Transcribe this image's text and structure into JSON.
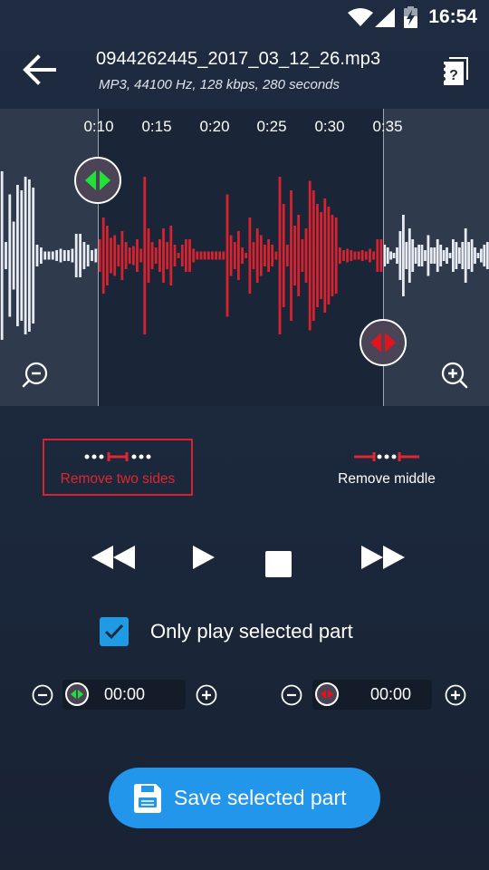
{
  "status_bar": {
    "time": "16:54",
    "icons": [
      "wifi-icon",
      "cellular-signal-icon",
      "battery-charging-icon"
    ]
  },
  "app_bar": {
    "back_icon": "arrow-left-icon",
    "title": "0944262445_2017_03_12_26.mp3",
    "subtitle": "MP3, 44100 Hz, 128 kbps, 280 seconds",
    "help_icon": "help-book-icon"
  },
  "waveform": {
    "timeline_ticks": [
      "0:10",
      "0:15",
      "0:20",
      "0:25",
      "0:30",
      "0:35"
    ],
    "selection_start_label": "0:10",
    "selection_end_label": "0:35",
    "selected_color": "#d7232f",
    "unselected_color": "#e8ecf2",
    "start_handle_color": "#22e03a",
    "end_handle_color": "#e0141e",
    "amplitudes_left": [
      0.62,
      0.1,
      0.45,
      0.25,
      0.52,
      0.48,
      0.58,
      0.56,
      0.5,
      0.08,
      0.06,
      0.03,
      0.03,
      0.03,
      0.04,
      0.05,
      0.04,
      0.04,
      0.05,
      0.16,
      0.16,
      0.1,
      0.08,
      0.04,
      0.05
    ],
    "amplitudes_selected": [
      0.12,
      0.28,
      0.22,
      0.13,
      0.15,
      0.08,
      0.18,
      0.1,
      0.06,
      0.07,
      0.12,
      0.05,
      0.58,
      0.2,
      0.1,
      0.06,
      0.12,
      0.2,
      0.1,
      0.22,
      0.08,
      0.02,
      0.08,
      0.12,
      0.12,
      0.05,
      0.03,
      0.03,
      0.03,
      0.03,
      0.03,
      0.03,
      0.03,
      0.03,
      0.45,
      0.15,
      0.1,
      0.18,
      0.06,
      0.02,
      0.28,
      0.1,
      0.2,
      0.15,
      0.08,
      0.12,
      0.08,
      0.03,
      0.58,
      0.38,
      0.08,
      0.48,
      0.22,
      0.3,
      0.12,
      0.2,
      0.55,
      0.48,
      0.38,
      0.32,
      0.42,
      0.36,
      0.3,
      0.28,
      0.06,
      0.04,
      0.05,
      0.04,
      0.03,
      0.03,
      0.04,
      0.03,
      0.05,
      0.03,
      0.12,
      0.12
    ],
    "amplitudes_right": [
      0.08,
      0.06,
      0.03,
      0.02,
      0.06,
      0.18,
      0.3,
      0.1,
      0.2,
      0.12,
      0.06,
      0.08,
      0.08,
      0.04,
      0.15,
      0.06,
      0.06,
      0.12,
      0.08,
      0.04,
      0.06,
      0.02,
      0.12,
      0.1,
      0.06,
      0.1,
      0.2,
      0.1,
      0.12,
      0.06,
      0.02,
      0.05,
      0.08,
      0.1
    ]
  },
  "zoom": {
    "zoom_out_icon": "zoom-out-icon",
    "zoom_in_icon": "zoom-in-icon"
  },
  "modes": [
    {
      "label": "Remove two sides",
      "selected": true
    },
    {
      "label": "Remove middle",
      "selected": false
    }
  ],
  "transport": {
    "rewind_icon": "rewind-icon",
    "play_icon": "play-icon",
    "stop_icon": "stop-icon",
    "forward_icon": "fast-forward-icon"
  },
  "only_play_selected": {
    "label": "Only play selected part",
    "checked": true
  },
  "start_time": {
    "value": "00:00"
  },
  "end_time": {
    "value": "00:00"
  },
  "save_button": {
    "label": "Save selected part",
    "color": "#2196ea"
  }
}
